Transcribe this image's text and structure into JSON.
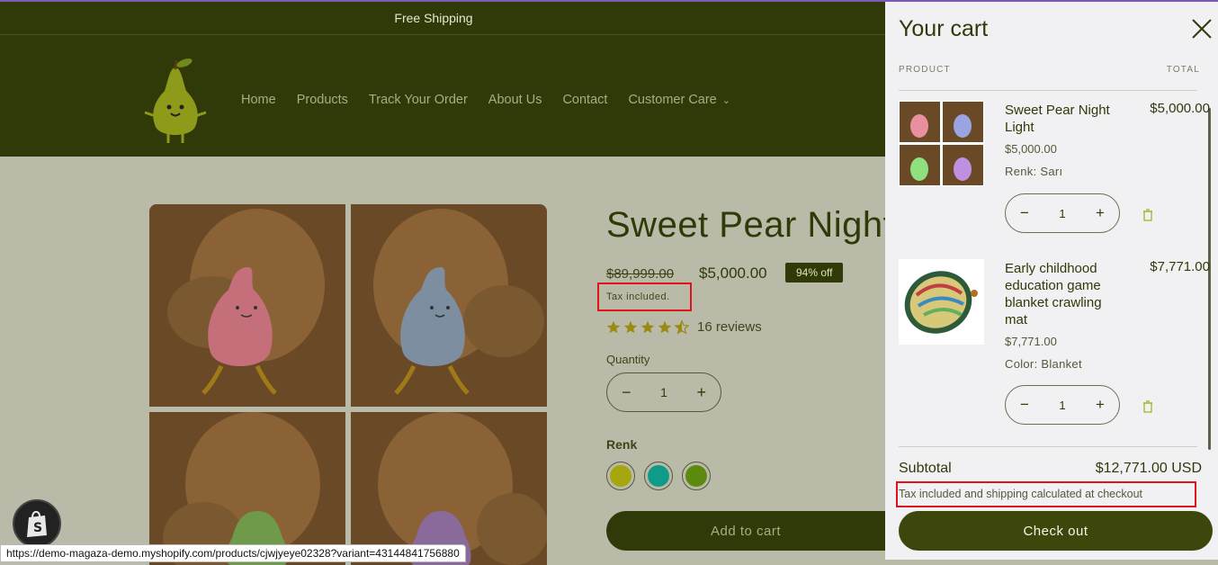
{
  "announcement": "Free Shipping",
  "nav": {
    "items": [
      "Home",
      "Products",
      "Track Your Order",
      "About Us",
      "Contact"
    ],
    "dropdown_label": "Customer Care"
  },
  "product": {
    "title": "Sweet Pear Night Light",
    "old_price": "$89,999.00",
    "price": "$5,000.00",
    "badge": "94% off",
    "tax_note": "Tax included.",
    "rating": 4.5,
    "reviews": "16 reviews",
    "quantity_label": "Quantity",
    "quantity": "1",
    "variant_label": "Renk",
    "swatches": [
      "#a6a60e",
      "#0f9a8a",
      "#5c8a0e"
    ],
    "add_to_cart": "Add to cart"
  },
  "status_url": "https://demo-magaza-demo.myshopify.com/products/cjwjyeye02328?variant=43144841756880",
  "cart": {
    "title": "Your cart",
    "col_product": "PRODUCT",
    "col_total": "TOTAL",
    "items": [
      {
        "name": "Sweet Pear Night Light",
        "price": "$5,000.00",
        "total": "$5,000.00",
        "option": "Renk: Sarı",
        "qty": "1"
      },
      {
        "name": "Early childhood education game blanket crawling mat",
        "price": "$7,771.00",
        "total": "$7,771.00",
        "option": "Color: Blanket",
        "qty": "1"
      }
    ],
    "subtotal_label": "Subtotal",
    "subtotal": "$12,771.00 USD",
    "tax_note": "Tax included and shipping calculated at checkout",
    "checkout": "Check out"
  },
  "colors": {
    "brand": "#2f3a08",
    "overlay": "#b9bba8",
    "highlight": "#e0131a"
  }
}
